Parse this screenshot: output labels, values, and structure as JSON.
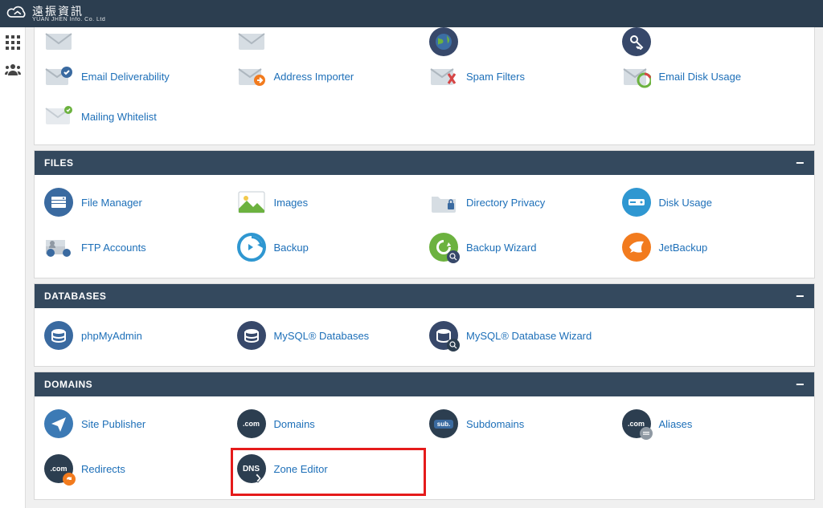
{
  "brand": {
    "main": "遠振資訊",
    "sub": "YUAN JHEN Info. Co. Ltd"
  },
  "email_section": {
    "items": [
      {
        "label": "Email Deliverability",
        "icon": "deliverability"
      },
      {
        "label": "Address Importer",
        "icon": "importer"
      },
      {
        "label": "Spam Filters",
        "icon": "spam"
      },
      {
        "label": "Email Disk Usage",
        "icon": "email-disk"
      },
      {
        "label": "Mailing Whitelist",
        "icon": "whitelist"
      }
    ]
  },
  "files_section": {
    "title": "FILES",
    "items": [
      {
        "label": "File Manager",
        "icon": "file-manager"
      },
      {
        "label": "Images",
        "icon": "images"
      },
      {
        "label": "Directory Privacy",
        "icon": "dir-privacy"
      },
      {
        "label": "Disk Usage",
        "icon": "disk-usage"
      },
      {
        "label": "FTP Accounts",
        "icon": "ftp"
      },
      {
        "label": "Backup",
        "icon": "backup"
      },
      {
        "label": "Backup Wizard",
        "icon": "backup-wizard"
      },
      {
        "label": "JetBackup",
        "icon": "jetbackup"
      }
    ]
  },
  "db_section": {
    "title": "DATABASES",
    "items": [
      {
        "label": "phpMyAdmin",
        "icon": "phpmyadmin"
      },
      {
        "label": "MySQL® Databases",
        "icon": "mysql"
      },
      {
        "label": "MySQL® Database Wizard",
        "icon": "mysql-wizard"
      }
    ]
  },
  "domains_section": {
    "title": "DOMAINS",
    "items": [
      {
        "label": "Site Publisher",
        "icon": "site-publisher"
      },
      {
        "label": "Domains",
        "icon": "domains"
      },
      {
        "label": "Subdomains",
        "icon": "subdomains"
      },
      {
        "label": "Aliases",
        "icon": "aliases"
      },
      {
        "label": "Redirects",
        "icon": "redirects"
      },
      {
        "label": "Zone Editor",
        "icon": "zone-editor",
        "highlight": true
      }
    ]
  }
}
